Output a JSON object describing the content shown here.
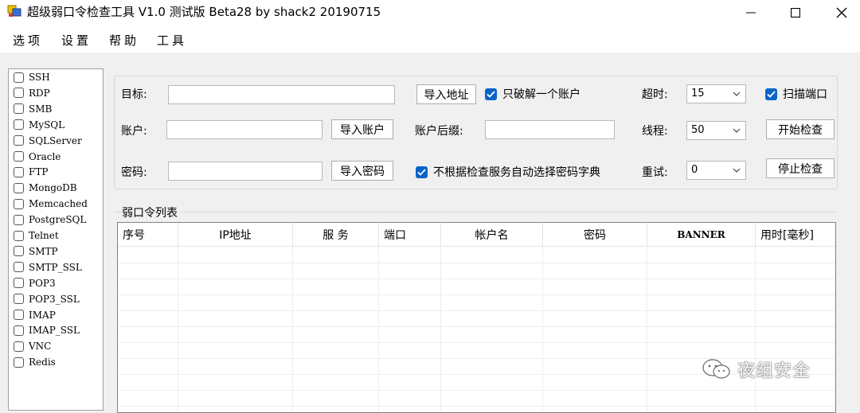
{
  "window": {
    "title": "超级弱口令检查工具 V1.0 测试版 Beta28 by shack2 20190715"
  },
  "menu": [
    "选项",
    "设置",
    "帮助",
    "工具"
  ],
  "services": [
    "SSH",
    "RDP",
    "SMB",
    "MySQL",
    "SQLServer",
    "Oracle",
    "FTP",
    "MongoDB",
    "Memcached",
    "PostgreSQL",
    "Telnet",
    "SMTP",
    "SMTP_SSL",
    "POP3",
    "POP3_SSL",
    "IMAP",
    "IMAP_SSL",
    "VNC",
    "Redis"
  ],
  "form": {
    "target_label": "目标:",
    "account_label": "账户:",
    "password_label": "密码:",
    "import_address": "导入地址",
    "import_account": "导入账户",
    "import_password": "导入密码",
    "only_one_account": "只破解一个账户",
    "account_suffix_label": "账户后缀:",
    "no_auto_dict": "不根据检查服务自动选择密码字典",
    "timeout_label": "超时:",
    "timeout_value": "15",
    "threads_label": "线程:",
    "threads_value": "50",
    "retry_label": "重试:",
    "retry_value": "0",
    "scan_port": "扫描端口",
    "start_check": "开始检查",
    "stop_check": "停止检查"
  },
  "results": {
    "title": "弱口令列表",
    "columns": [
      "序号",
      "IP地址",
      "服 务",
      "端口",
      "帐户名",
      "密码",
      "BANNER",
      "用时[毫秒]"
    ]
  },
  "watermark": "夜组安全"
}
